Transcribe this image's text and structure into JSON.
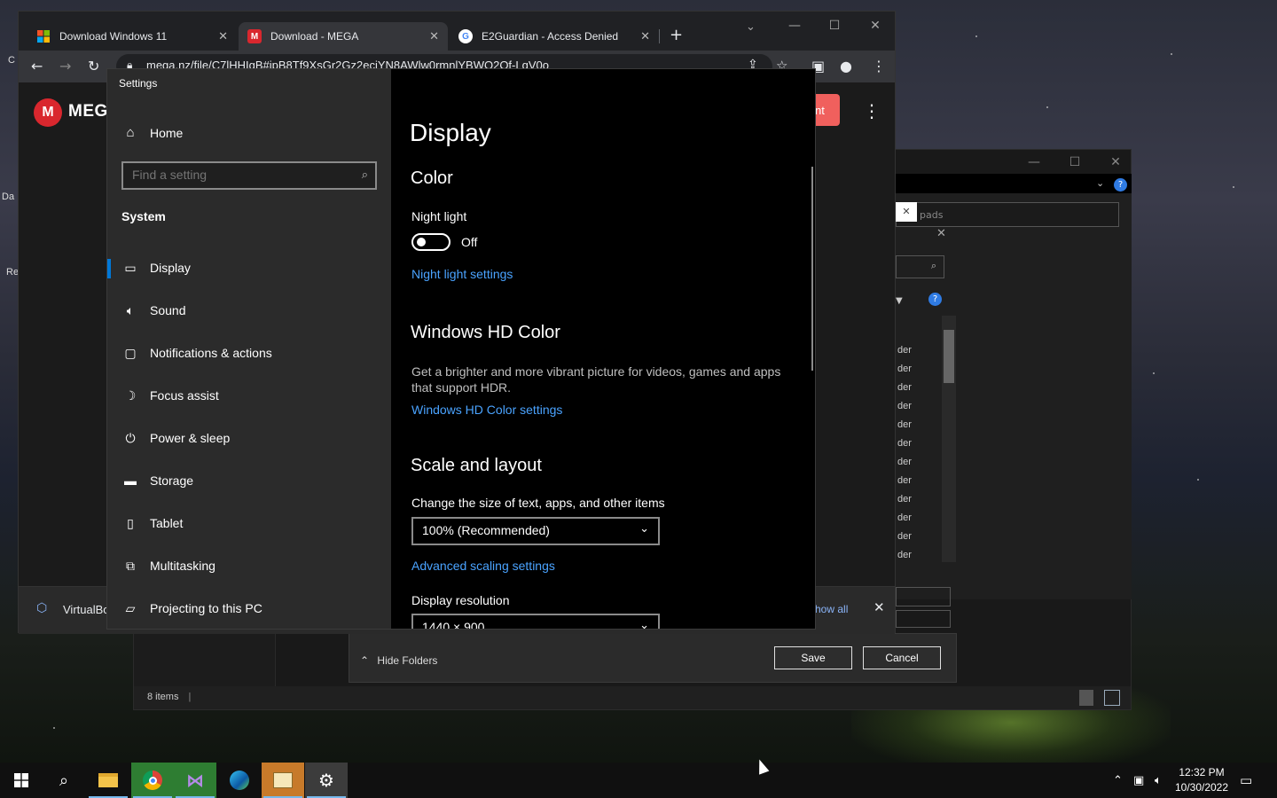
{
  "chrome": {
    "tabs": [
      {
        "title": "Download Windows 11",
        "icon": "windows-logo-icon"
      },
      {
        "title": "Download - MEGA",
        "icon": "mega-logo-icon"
      },
      {
        "title": "E2Guardian - Access Denied",
        "icon": "google-logo-icon"
      }
    ],
    "url": "mega.nz/file/C7lHHIgB#jpB8Tf9XsGr2Gz2ecjYN8AWlw0rmnlYBWO2Of-LqV0o",
    "mega_brand": "MEG",
    "mega_logo_letter": "M",
    "mega_button_partial": "nt",
    "banner_app": "VirtualBo",
    "banner_show_all": "how all"
  },
  "desktop": {
    "edge_texts": [
      "C",
      "Da",
      "Re"
    ]
  },
  "settings": {
    "window_title": "Settings",
    "nav": {
      "home": "Home",
      "search_placeholder": "Find a setting",
      "section": "System",
      "items": [
        {
          "label": "Display",
          "icon": "monitor-icon"
        },
        {
          "label": "Sound",
          "icon": "speaker-icon"
        },
        {
          "label": "Notifications & actions",
          "icon": "notification-icon"
        },
        {
          "label": "Focus assist",
          "icon": "moon-icon"
        },
        {
          "label": "Power & sleep",
          "icon": "power-icon"
        },
        {
          "label": "Storage",
          "icon": "storage-icon"
        },
        {
          "label": "Tablet",
          "icon": "tablet-icon"
        },
        {
          "label": "Multitasking",
          "icon": "multitasking-icon"
        },
        {
          "label": "Projecting to this PC",
          "icon": "projector-icon"
        }
      ],
      "selected": "Display"
    },
    "main": {
      "title": "Display",
      "color_heading": "Color",
      "night_light_label": "Night light",
      "night_light_state": "Off",
      "night_light_link": "Night light settings",
      "hd_heading": "Windows HD Color",
      "hd_desc": "Get a brighter and more vibrant picture for videos, games and apps that support HDR.",
      "hd_link": "Windows HD Color settings",
      "scale_heading": "Scale and layout",
      "scale_label": "Change the size of text, apps, and other items",
      "scale_value": "100% (Recommended)",
      "advanced_link": "Advanced scaling settings",
      "resolution_label": "Display resolution",
      "resolution_value": "1440 × 900"
    }
  },
  "save_dialog": {
    "hide_folders": "Hide Folders",
    "save": "Save",
    "cancel": "Cancel",
    "path_partial": "pads",
    "file_items": [
      "der",
      "der",
      "der",
      "der",
      "der",
      "der",
      "der",
      "der",
      "der",
      "der",
      "der",
      "der"
    ]
  },
  "explorer": {
    "status": "8 items"
  },
  "taskbar": {
    "time": "12:32 PM",
    "date": "10/30/2022"
  }
}
